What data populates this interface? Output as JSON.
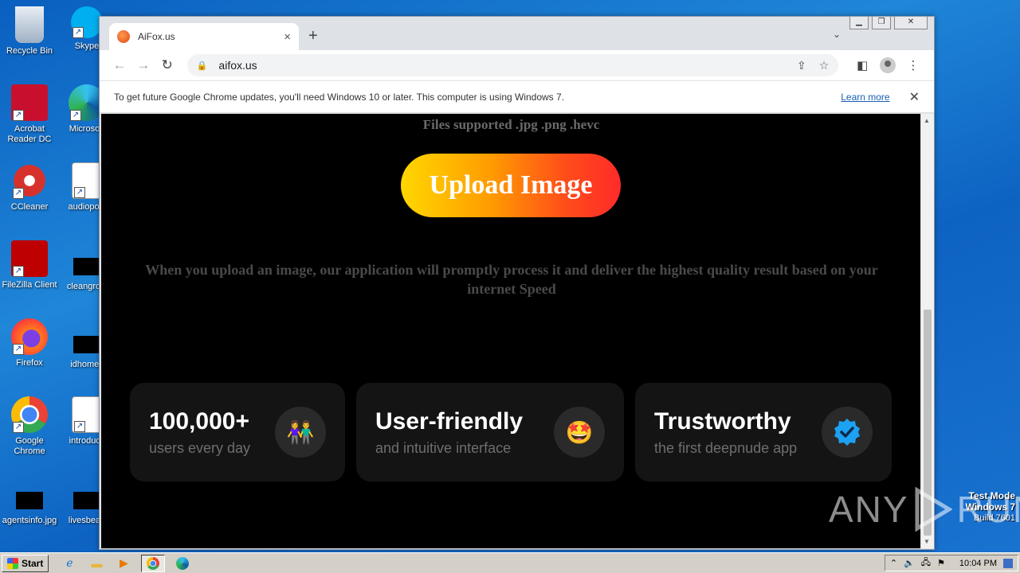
{
  "desktop": {
    "icons": [
      {
        "label": "Recycle Bin"
      },
      {
        "label": "Skype"
      },
      {
        "label": "Acrobat Reader DC"
      },
      {
        "label": "Microsoft"
      },
      {
        "label": "CCleaner"
      },
      {
        "label": "audiopolit"
      },
      {
        "label": "FileZilla Client"
      },
      {
        "label": "cleangrow"
      },
      {
        "label": "Firefox"
      },
      {
        "label": "idhomes"
      },
      {
        "label": "Google Chrome"
      },
      {
        "label": "introducti"
      },
      {
        "label": "agentsinfo.jpg"
      },
      {
        "label": "livesbead"
      }
    ],
    "mode": {
      "line1": "Test Mode",
      "line2": "Windows 7",
      "line3": "Build 7601"
    }
  },
  "browser": {
    "tab_title": "AiFox.us",
    "tab_close": "×",
    "new_tab": "+",
    "url": "aifox.us",
    "infobar_message": "To get future Google Chrome updates, you'll need Windows 10 or later. This computer is using Windows 7.",
    "infobar_link": "Learn more",
    "infobar_close": "✕"
  },
  "page": {
    "files_note": "Files supported .jpg .png .hevc",
    "upload_label": "Upload Image",
    "description": "When you upload an image, our application will promptly process it and deliver the highest quality result based on your internet Speed",
    "cards": [
      {
        "title": "100,000+",
        "subtitle": "users every day",
        "icon": "people-holding-hands-icon",
        "emoji": "👫"
      },
      {
        "title": "User-friendly",
        "subtitle": "and intuitive interface",
        "icon": "star-struck-face-icon",
        "emoji": "🤩"
      },
      {
        "title": "Trustworthy",
        "subtitle": "the first deepnude app",
        "icon": "verified-badge-icon"
      }
    ]
  },
  "watermark": {
    "left": "ANY",
    "right": "RUN"
  },
  "taskbar": {
    "start_label": "Start",
    "clock": "10:04 PM"
  },
  "colors": {
    "upload_gradient_start": "#ffd700",
    "upload_gradient_end": "#ff2a2a",
    "card_bg": "#141414",
    "verified_blue": "#1da1f2"
  }
}
